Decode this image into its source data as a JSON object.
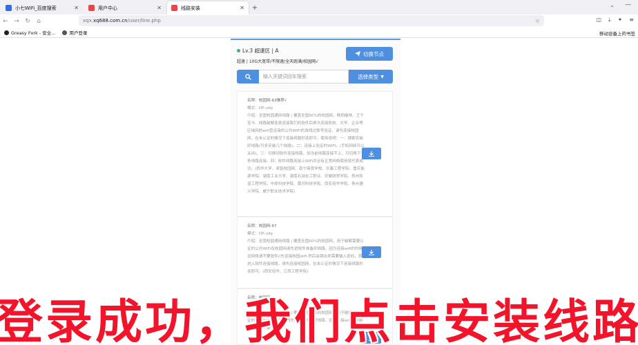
{
  "browser": {
    "tabs": [
      {
        "title": "小七WiFi_百度搜索",
        "color": "#2f6fe0",
        "active": false
      },
      {
        "title": "用户中心",
        "color": "#e84545",
        "active": false
      },
      {
        "title": "线路安装",
        "color": "#e84545",
        "active": true
      }
    ],
    "url_prefix": "xqx.",
    "url_domain": "xq688.com.cn",
    "url_path": "/user/line.php",
    "bookmarks": [
      {
        "label": "Greasy Fork - 安全..."
      },
      {
        "label": "用户登录"
      }
    ],
    "mobile_bookmarks": "移动设备上的书签"
  },
  "page": {
    "status": "Lv.3 超速区 | A",
    "subline": "超速 | 10G大宽带/不限速/全天跑满/校园网√",
    "switch_label": "切换节点",
    "search_placeholder": "输入关键词回车搜索",
    "type_label": "选择类型"
  },
  "cards": [
    {
      "name": "名称：校园网-63推荐√",
      "mode": "模式：OP-udp",
      "intro": "介绍：全国校园通用线路 | 覆盖全国60%的校园网，陕西榆林、王千宝卡、线路破解各类连接我们的软件后再次连接防校、大学、企业等区域网的wifi营运商的公共WIFI的游戏过账号验证。请先连接校园网，在未认证的情况下连接线路秒连即可。使用说明：一：搜索安装好线路(可多安装几个线路)。二：连接上验证的WIFI。(手机网络可以关闭)。三：切换到软件连接线路，如当前线路连接不上，可切换下一条线路连接。四：软件线路连接上WiFi并且有正常网络使用就代表成功。(西华大学、卓智校园网、南宁商贸学校、长春工程学院、重庆能源学院、湖南工业大学、湖南石油化工职业、安徽财贸学院、郑州轨道工程学院、中原科技学院、黄河科技学院、西安培华学院、贵州遵义学院、威宁职业技术学院)"
    },
    {
      "name": "名称：校园网-67",
      "mode": "模式：OP-udp",
      "intro": "介绍：全国校园通用线路 | 覆盖全国60%的校园网，用于破解需要认证的公共WIFI及校园网请先进软件准备好线路。因为连接wifi的时候设网络请不要软件//先连接校园wifi-然后会跳出来需要输入密码，就进入软件连接线路，请先连接校园网，在未认证的情况下连接线路秒连即可。(西安培华、江西工程学院)"
    },
    {
      "name": "名称：校园网-",
      "mode": "模式：",
      "intro": "介绍：全国校园通用线路 | 覆盖全国60%的校园网，用于破解需要认证的公共WIFI及校园网请先进软件准备好线路，因为连接wifi的时候设网络请不要软件"
    }
  ],
  "caption": "登录成功，我们点击安装线路",
  "colors": {
    "accent": "#4e8fe0",
    "online": "#3cb371",
    "caption": "#f2142b"
  }
}
